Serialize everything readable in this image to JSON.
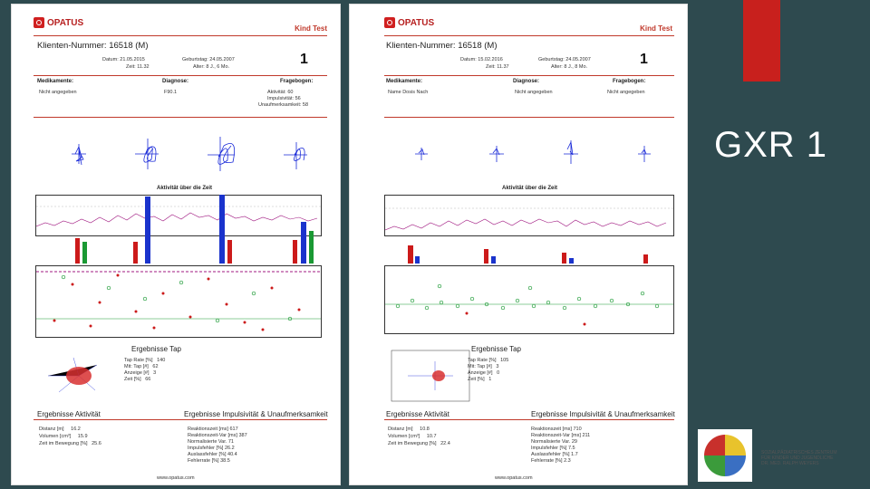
{
  "slide": {
    "title": "GXR 1"
  },
  "reports": [
    {
      "brand": "OPATUS",
      "product": "Kind Test",
      "client_label": "Klienten-Nummer:",
      "client_number": "16518",
      "sex": "(M)",
      "test_no": "1",
      "date_label": "Datum: 21.05.2015",
      "time_label": "Zeit: 11.32",
      "birth_label": "Geburtstag: 24.05.2007",
      "age_label": "Alter: 8 J., 6 Mo.",
      "meds_label": "Medikamente:",
      "meds_value": "Nicht angegeben",
      "diag_label": "Diagnose:",
      "diag_value": "F90.1",
      "questionnaire_label": "Fragebogen:",
      "q_rows": [
        [
          "Aktivität:",
          "60"
        ],
        [
          "Impulsivität:",
          "56"
        ],
        [
          "Unaufmerksamkeit:",
          "58"
        ]
      ],
      "activity_chart_title": "Aktivität über die Zeit",
      "results_tap_title": "Ergebnisse Tap",
      "tap_rows": [
        [
          "Tap Rate [%]",
          "140"
        ],
        [
          "Mit: Tap [#]",
          "62"
        ],
        [
          "Anzeige [#]",
          "3"
        ],
        [
          "Zeit [%]",
          "66"
        ]
      ],
      "activity_title": "Ergebnisse Aktivität",
      "imp_title": "Ergebnisse Impulsivität & Unaufmerksamkeit",
      "activity_rows": [
        [
          "Distanz [m]",
          "16.2"
        ],
        [
          "Volumen [cm³]",
          "15.9"
        ],
        [
          "Zeit im Bewegung [%]",
          "25.6"
        ]
      ],
      "imp_rows": [
        [
          "Reaktionszeit [ms]",
          "617"
        ],
        [
          "Reaktionszeit-Var [ms]",
          "387"
        ],
        [
          "Normalisierte Var.",
          "71"
        ],
        [
          "Impulsfehler [%]",
          "26.2"
        ],
        [
          "Auslassfehler [%]",
          "40.4"
        ],
        [
          "Fehlerrate [%]",
          "38.5"
        ]
      ],
      "footer_site": "www.opatus.com"
    },
    {
      "brand": "OPATUS",
      "product": "Kind Test",
      "client_label": "Klienten-Nummer:",
      "client_number": "16518",
      "sex": "(M)",
      "test_no": "1",
      "date_label": "Datum: 15.02.2016",
      "time_label": "Zeit: 11.37",
      "birth_label": "Geburtstag: 24.05.2007",
      "age_label": "Alter: 8 J., 8 Mo.",
      "meds_label": "Medikamente:",
      "meds_value": "Name   Dosis   Nach",
      "diag_label": "Diagnose:",
      "diag_value": "Nicht angegeben",
      "questionnaire_label": "Fragebogen:",
      "q_rows": [
        [
          "Nicht angegeben",
          ""
        ]
      ],
      "activity_chart_title": "Aktivität über die Zeit",
      "results_tap_title": "Ergebnisse Tap",
      "tap_rows": [
        [
          "Tap Rate [%]",
          "105"
        ],
        [
          "Mit: Tap [#]",
          "3"
        ],
        [
          "Anzeige [#]",
          "0"
        ],
        [
          "Zeit [%]",
          "1"
        ]
      ],
      "activity_title": "Ergebnisse Aktivität",
      "imp_title": "Ergebnisse Impulsivität & Unaufmerksamkeit",
      "activity_rows": [
        [
          "Distanz [m]",
          "10.8"
        ],
        [
          "Volumen [cm³]",
          "10.7"
        ],
        [
          "Zeit im Bewegung [%]",
          "22.4"
        ]
      ],
      "imp_rows": [
        [
          "Reaktionszeit [ms]",
          "710"
        ],
        [
          "Reaktionszeit-Var [ms]",
          "211"
        ],
        [
          "Normalisierte Var.",
          "29"
        ],
        [
          "Impulsfehler [%]",
          "7.5"
        ],
        [
          "Auslassfehler [%]",
          "1.7"
        ],
        [
          "Fehlerrate [%]",
          "2.3"
        ]
      ],
      "footer_site": "www.opatus.com"
    }
  ],
  "org_logo": {
    "lines": [
      "SOZIALPÄDIATRISCHES ZENTRUM",
      "FÜR KINDER UND JUGENDLICHE",
      "DR. MED. RALPH WEYERS"
    ]
  },
  "colors": {
    "background": "#2e4a4f",
    "accent": "#c8201d",
    "bar_blue": "#1a33cc",
    "bar_red": "#cc1a1a",
    "bar_green": "#1a9933",
    "trace_purple": "#a01880"
  }
}
